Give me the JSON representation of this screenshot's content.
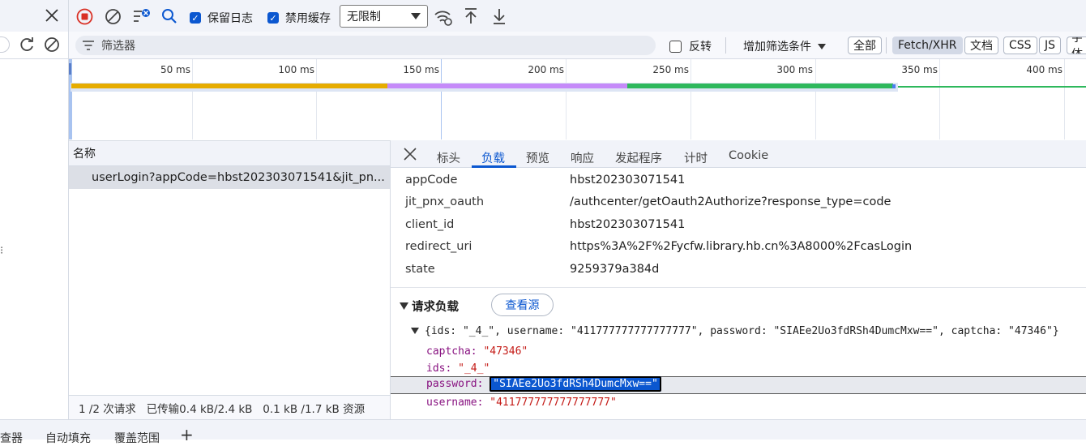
{
  "colors": {
    "accent": "#0b57d0",
    "record_stop": "#d93025",
    "bar_waiting": "#e6ac00",
    "bar_ttfb": "#c58af9",
    "bar_download": "#2eb85c"
  },
  "toolbar": {
    "stop_icon": "record-stop-icon",
    "clear_icon": "clear-icon",
    "filter_settings_icon": "filter-settings-icon",
    "search_icon": "search-icon",
    "preserve_log_label": "保留日志",
    "disable_cache_label": "禁用缓存",
    "throttle_value": "无限制",
    "wifi_icon": "network-conditions-icon",
    "upload_icon": "import-har-icon",
    "download_icon": "export-har-icon"
  },
  "filterbar": {
    "placeholder": "筛选器",
    "invert_label": "反转",
    "more_filters_label": "增加筛选条件",
    "chips": [
      "全部",
      "Fetch/XHR",
      "文档",
      "CSS",
      "JS",
      "字体"
    ]
  },
  "timeline": {
    "ticks": [
      "50 ms",
      "100 ms",
      "150 ms",
      "200 ms",
      "250 ms",
      "300 ms",
      "350 ms",
      "400 ms"
    ]
  },
  "request_list": {
    "header": "名称",
    "rows": [
      "userLogin?appCode=hbst202303071541&jit_pn..."
    ],
    "status": "1 /2 次请求   已传输0.4 kB/2.4 kB   0.1 kB /1.7 kB 资源"
  },
  "detail": {
    "tabs": [
      "标头",
      "负载",
      "预览",
      "响应",
      "发起程序",
      "计时",
      "Cookie"
    ],
    "query_params": [
      {
        "key": "appCode",
        "value": "hbst202303071541"
      },
      {
        "key": "jit_pnx_oauth",
        "value": "/authcenter/getOauth2Authorize?response_type=code"
      },
      {
        "key": "client_id",
        "value": "hbst202303071541"
      },
      {
        "key": "redirect_uri",
        "value": "https%3A%2F%2Fycfw.library.hb.cn%3A8000%2FcasLogin"
      },
      {
        "key": "state",
        "value": "9259379a384d"
      }
    ],
    "payload_title": "请求负载",
    "view_source_label": "查看源",
    "payload_summary": "{ids: \"_4_\", username: \"411777777777777777\", password: \"SIAEe2Uo3fdRSh4DumcMxw==\", captcha: \"47346\"}",
    "payload_fields": [
      {
        "key": "captcha",
        "value": "\"47346\""
      },
      {
        "key": "ids",
        "value": "\"_4_\""
      },
      {
        "key": "password",
        "value": "\"SIAEe2Uo3fdRSh4DumcMxw==\""
      },
      {
        "key": "username",
        "value": "\"411777777777777777\""
      }
    ]
  },
  "bottom_tabs": [
    "查器",
    "自动填充",
    "覆盖范围",
    "+"
  ]
}
